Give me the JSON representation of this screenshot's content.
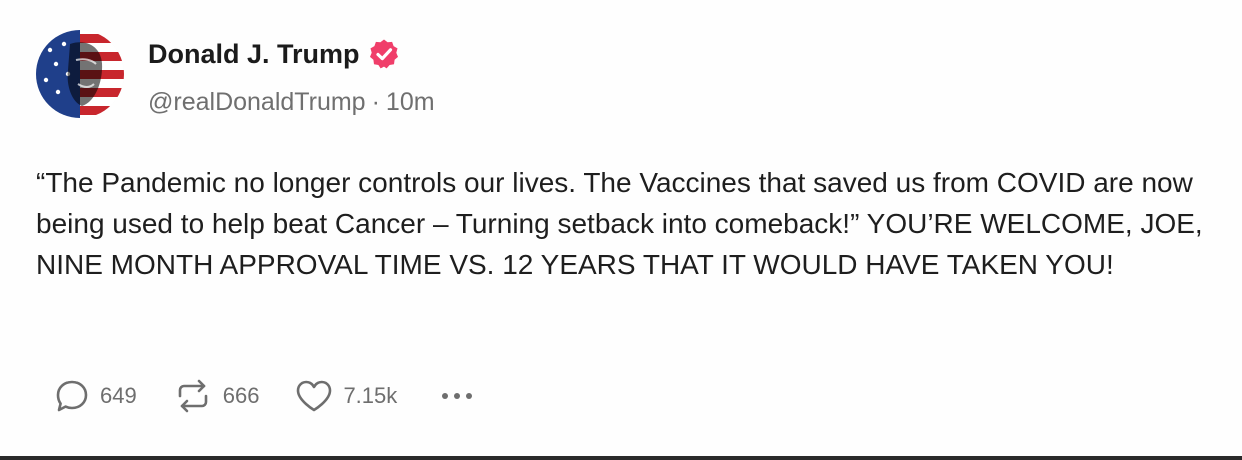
{
  "post": {
    "author": {
      "display_name": "Donald J. Trump",
      "handle": "@realDonaldTrump",
      "verified_badge_icon": "verified-check-badge",
      "badge_color": "#f03e6a"
    },
    "separator": "·",
    "timestamp": "10m",
    "text": "“The Pandemic no longer controls our lives. The Vaccines that saved us from COVID are now being used to help beat Cancer – Turning setback into comeback!” YOU’RE WELCOME, JOE, NINE MONTH APPROVAL TIME VS. 12 YEARS THAT IT WOULD HAVE TAKEN YOU!",
    "actions": {
      "replies": "649",
      "reposts": "666",
      "likes": "7.15k",
      "reply_icon": "speech-bubble",
      "repost_icon": "repost-arrows",
      "like_icon": "heart",
      "more_icon": "ellipsis"
    }
  }
}
